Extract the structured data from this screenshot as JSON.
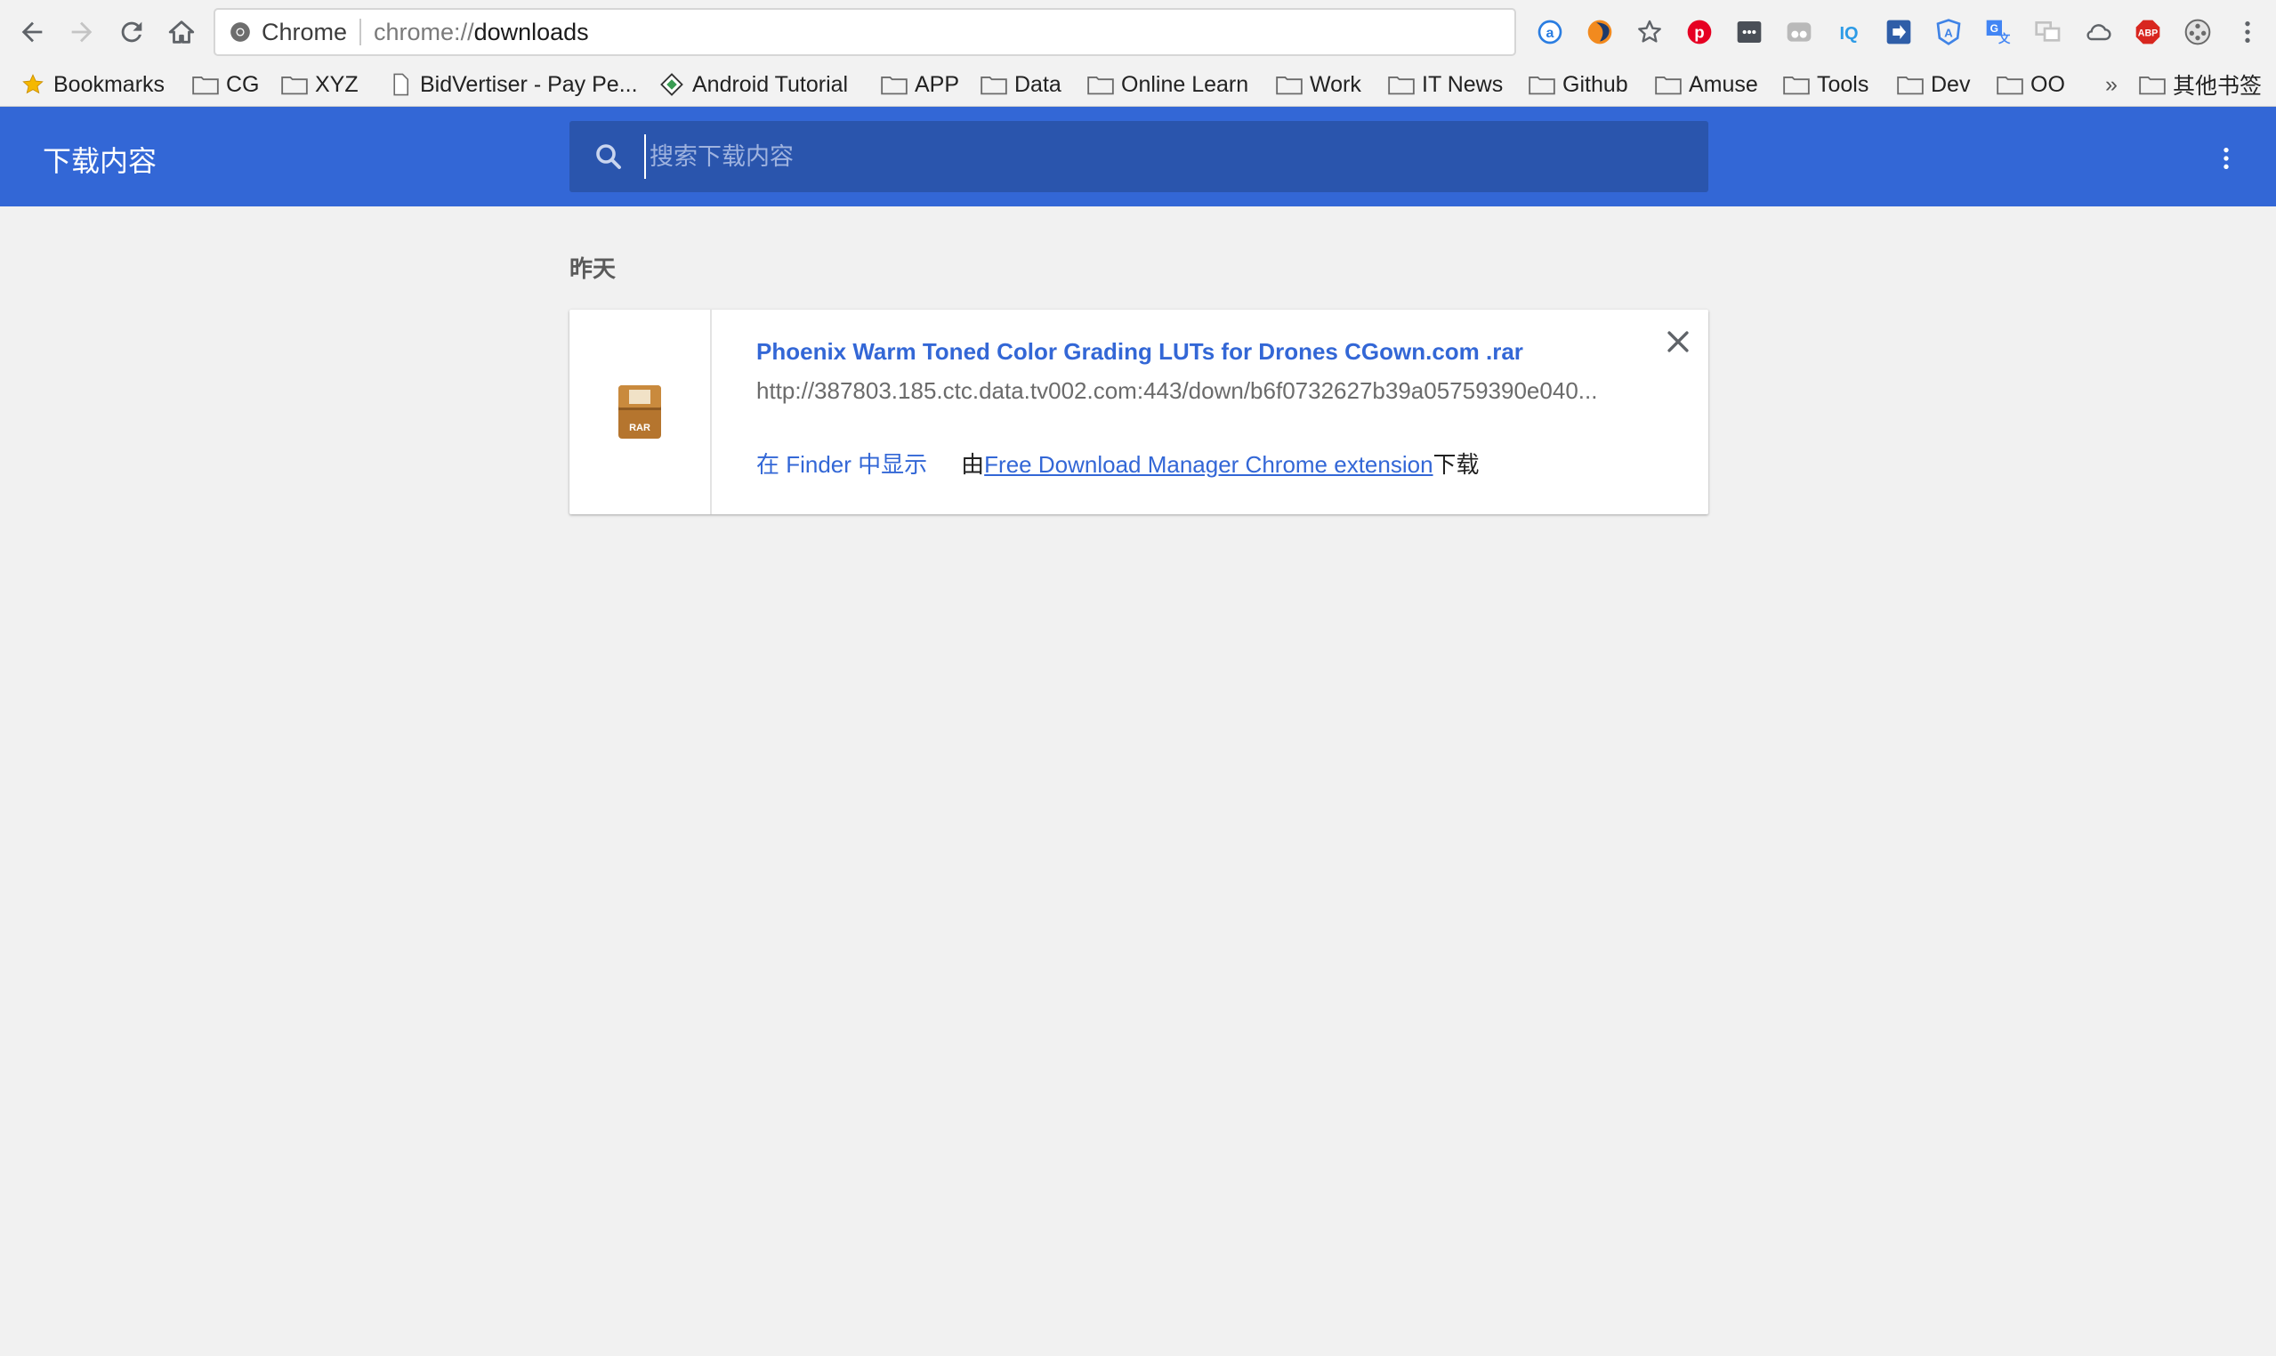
{
  "browser": {
    "omnibox": {
      "site_name": "Chrome",
      "url_scheme": "chrome://",
      "url_host": "downloads"
    },
    "extensions": [
      "a-icon",
      "flame-icon",
      "star-icon",
      "pinterest-icon",
      "dots-box-icon",
      "glasses-icon",
      "iq-icon",
      "share-arrow-icon",
      "angular-shield-icon",
      "translate-icon",
      "screen-share-icon",
      "cloud-icon",
      "adblock-abp-icon",
      "film-reel-icon"
    ]
  },
  "bookmarks": {
    "items": [
      {
        "label": "Bookmarks",
        "icon": "star-icon"
      },
      {
        "label": "CG",
        "icon": "folder-icon"
      },
      {
        "label": "XYZ",
        "icon": "folder-icon"
      },
      {
        "label": "BidVertiser - Pay Pe...",
        "icon": "page-icon"
      },
      {
        "label": "Android Tutorial",
        "icon": "diamond-icon"
      },
      {
        "label": "APP",
        "icon": "folder-icon"
      },
      {
        "label": "Data",
        "icon": "folder-icon"
      },
      {
        "label": "Online Learn",
        "icon": "folder-icon"
      },
      {
        "label": "Work",
        "icon": "folder-icon"
      },
      {
        "label": "IT News",
        "icon": "folder-icon"
      },
      {
        "label": "Github",
        "icon": "folder-icon"
      },
      {
        "label": "Amuse",
        "icon": "folder-icon"
      },
      {
        "label": "Tools",
        "icon": "folder-icon"
      },
      {
        "label": "Dev",
        "icon": "folder-icon"
      },
      {
        "label": "OO",
        "icon": "folder-icon"
      }
    ],
    "overflow": "»",
    "other": "其他书签"
  },
  "header": {
    "title": "下载内容",
    "search_placeholder": "搜索下载内容"
  },
  "downloads": {
    "date_group": "昨天",
    "items": [
      {
        "file_name": "Phoenix Warm Toned Color Grading LUTs for Drones CGown.com .rar",
        "url": "http://387803.185.ctc.data.tv002.com:443/down/b6f0732627b39a05759390e040...",
        "file_icon_label": "RAR",
        "show_in_finder": "在 Finder 中显示",
        "by_prefix": "由",
        "by_extension": "Free Download Manager Chrome extension",
        "by_suffix": "下载"
      }
    ]
  },
  "colors": {
    "accent": "#3367d6",
    "header_bg": "#3367d6",
    "search_bg": "#2a55ad",
    "page_bg": "#f1f1f1"
  }
}
